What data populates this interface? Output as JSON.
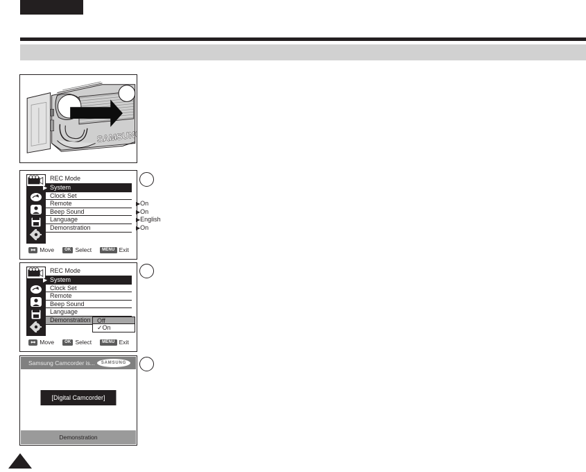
{
  "page": {
    "tab_label": "",
    "section_title": "",
    "page_number": ""
  },
  "steps": {
    "photo_caption": "",
    "circle_1": "",
    "circle_2": "",
    "circle_3": ""
  },
  "photo": {
    "brand_text": "SAMSUNG",
    "alt": "camcorder-side-view-illustration"
  },
  "menu_screen_1": {
    "header": "REC Mode",
    "rows": [
      {
        "label": "System",
        "arrow": "▶",
        "selected": true,
        "value": "",
        "value_arrow": ""
      },
      {
        "label": "Clock Set",
        "arrow": "",
        "selected": false,
        "value": "",
        "value_arrow": ""
      },
      {
        "label": "Remote",
        "arrow": "",
        "selected": false,
        "value": "On",
        "value_arrow": "▶"
      },
      {
        "label": "Beep Sound",
        "arrow": "",
        "selected": false,
        "value": "On",
        "value_arrow": "▶"
      },
      {
        "label": "Language",
        "arrow": "",
        "selected": false,
        "value": "English",
        "value_arrow": "▶"
      },
      {
        "label": "Demonstration",
        "arrow": "",
        "selected": false,
        "value": "On",
        "value_arrow": "▶"
      }
    ],
    "hints": {
      "move": "Move",
      "select": "Select",
      "exit": "Exit",
      "ok_badge": "OK",
      "menu_badge": "MENU"
    },
    "rail_icons": [
      "camcorder-tape-icon",
      "photo-camera-icon",
      "person-playback-icon",
      "memory-card-icon",
      "system-gear-icon"
    ]
  },
  "menu_screen_2": {
    "header": "REC Mode",
    "rows": [
      {
        "label": "System",
        "arrow": "▶",
        "selected": true,
        "gray": false
      },
      {
        "label": "Clock Set",
        "arrow": "",
        "selected": false,
        "gray": false
      },
      {
        "label": "Remote",
        "arrow": "",
        "selected": false,
        "gray": false
      },
      {
        "label": "Beep Sound",
        "arrow": "",
        "selected": false,
        "gray": false
      },
      {
        "label": "Language",
        "arrow": "",
        "selected": false,
        "gray": false
      },
      {
        "label": "Demonstration",
        "arrow": "",
        "selected": false,
        "gray": true
      }
    ],
    "submenu": {
      "option_off": "Off",
      "option_on": "On",
      "check_mark": "✓"
    },
    "hints": {
      "move": "Move",
      "select": "Select",
      "exit": "Exit",
      "ok_badge": "OK",
      "menu_badge": "MENU"
    }
  },
  "demo_screen": {
    "header_text": "Samsung Camcorder is...",
    "logo_text": "SAMSUNG",
    "box_text": "[Digital Camcorder]",
    "footer_text": "Demonstration"
  },
  "colors": {
    "ink": "#231f20",
    "band": "#d1d1d1",
    "osd_highlight": "#a6a6a6",
    "demo_header": "#808080",
    "demo_footer": "#9a9a9a"
  }
}
